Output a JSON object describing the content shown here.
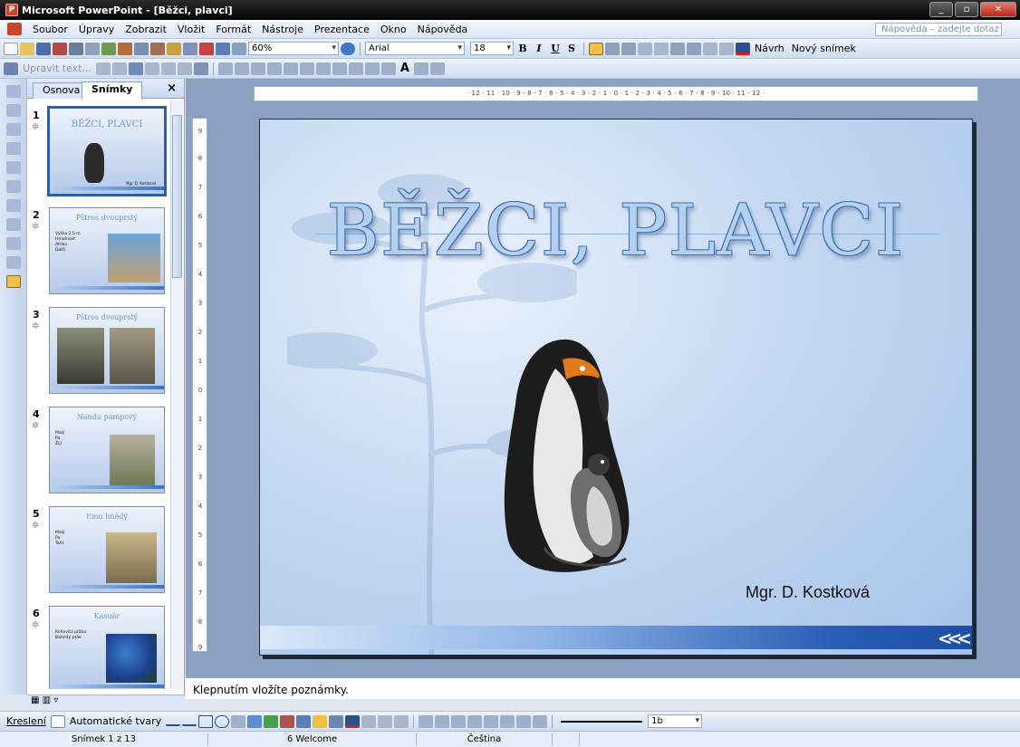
{
  "window": {
    "title": "Microsoft PowerPoint - [Běžci, plavci]",
    "app_icon_letter": "P"
  },
  "menu": {
    "items": [
      "Soubor",
      "Úpravy",
      "Zobrazit",
      "Vložit",
      "Formát",
      "Nástroje",
      "Prezentace",
      "Okno",
      "Nápověda"
    ],
    "help_placeholder": "Nápověda – zadejte dotaz"
  },
  "toolbar_standard": {
    "zoom": "60%"
  },
  "toolbar_format": {
    "font": "Arial",
    "size": "18",
    "bold": "B",
    "italic": "I",
    "underline": "U",
    "shadow": "S",
    "design_label": "Návrh",
    "new_slide_label": "Nový snímek"
  },
  "toolbar_outline": {
    "edit_text_label": "Upravit text..."
  },
  "panel": {
    "tabs": [
      "Osnova",
      "Snímky"
    ],
    "close": "×",
    "thumbs": [
      {
        "num": "1",
        "title": "BĚŽCI, PLAVCI",
        "subtitle": "Mgr. D. Kostková"
      },
      {
        "num": "2",
        "title": "Pštros dvouprstý",
        "bullets": [
          "Výška 2,5 m",
          "Hmotnost",
          "Afrika",
          "Další"
        ]
      },
      {
        "num": "3",
        "title": "Pštros dvouprstý",
        "bullets": []
      },
      {
        "num": "4",
        "title": "Nandu pampový",
        "bullets": [
          "Malý",
          "Pa",
          "Žijí"
        ]
      },
      {
        "num": "5",
        "title": "Emu hnědý",
        "bullets": [
          "Malý",
          "Pa",
          "Tahl"
        ]
      },
      {
        "num": "6",
        "title": "Kasuár",
        "bullets": [
          "Rohovitá přilba",
          "Bahnitý pták"
        ]
      }
    ]
  },
  "slide": {
    "title": "BĚŽCI, PLAVCI",
    "author": "Mgr. D. Kostková"
  },
  "notes": {
    "placeholder": "Klepnutím vložíte poznámky."
  },
  "drawing_toolbar": {
    "draw_label": "Kreslení",
    "autoshapes_label": "Automatické tvary",
    "font_size": "1b"
  },
  "status": {
    "slide": "Snímek 1 z 13",
    "design": "6 Welcome",
    "language": "Čeština"
  },
  "colors": {
    "titlebar": "#0a0a0a",
    "slide_bg": "#b4cdee",
    "title_fill": "#b3d0f0",
    "title_outline": "#3f6fae",
    "selection": "#2e5ea8"
  }
}
